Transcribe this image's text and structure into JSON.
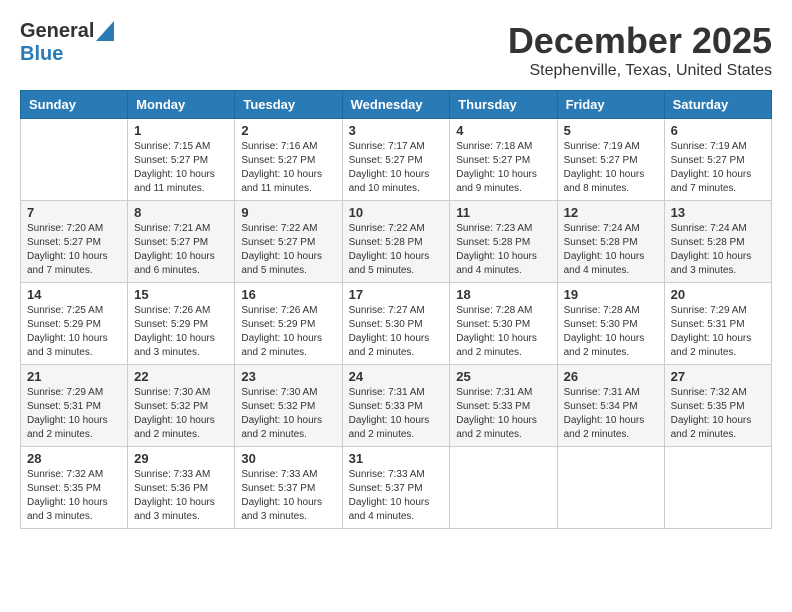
{
  "header": {
    "logo_line1": "General",
    "logo_line2": "Blue",
    "month_title": "December 2025",
    "location": "Stephenville, Texas, United States"
  },
  "days_of_week": [
    "Sunday",
    "Monday",
    "Tuesday",
    "Wednesday",
    "Thursday",
    "Friday",
    "Saturday"
  ],
  "weeks": [
    [
      {
        "day": "",
        "info": ""
      },
      {
        "day": "1",
        "info": "Sunrise: 7:15 AM\nSunset: 5:27 PM\nDaylight: 10 hours\nand 11 minutes."
      },
      {
        "day": "2",
        "info": "Sunrise: 7:16 AM\nSunset: 5:27 PM\nDaylight: 10 hours\nand 11 minutes."
      },
      {
        "day": "3",
        "info": "Sunrise: 7:17 AM\nSunset: 5:27 PM\nDaylight: 10 hours\nand 10 minutes."
      },
      {
        "day": "4",
        "info": "Sunrise: 7:18 AM\nSunset: 5:27 PM\nDaylight: 10 hours\nand 9 minutes."
      },
      {
        "day": "5",
        "info": "Sunrise: 7:19 AM\nSunset: 5:27 PM\nDaylight: 10 hours\nand 8 minutes."
      },
      {
        "day": "6",
        "info": "Sunrise: 7:19 AM\nSunset: 5:27 PM\nDaylight: 10 hours\nand 7 minutes."
      }
    ],
    [
      {
        "day": "7",
        "info": "Sunrise: 7:20 AM\nSunset: 5:27 PM\nDaylight: 10 hours\nand 7 minutes."
      },
      {
        "day": "8",
        "info": "Sunrise: 7:21 AM\nSunset: 5:27 PM\nDaylight: 10 hours\nand 6 minutes."
      },
      {
        "day": "9",
        "info": "Sunrise: 7:22 AM\nSunset: 5:27 PM\nDaylight: 10 hours\nand 5 minutes."
      },
      {
        "day": "10",
        "info": "Sunrise: 7:22 AM\nSunset: 5:28 PM\nDaylight: 10 hours\nand 5 minutes."
      },
      {
        "day": "11",
        "info": "Sunrise: 7:23 AM\nSunset: 5:28 PM\nDaylight: 10 hours\nand 4 minutes."
      },
      {
        "day": "12",
        "info": "Sunrise: 7:24 AM\nSunset: 5:28 PM\nDaylight: 10 hours\nand 4 minutes."
      },
      {
        "day": "13",
        "info": "Sunrise: 7:24 AM\nSunset: 5:28 PM\nDaylight: 10 hours\nand 3 minutes."
      }
    ],
    [
      {
        "day": "14",
        "info": "Sunrise: 7:25 AM\nSunset: 5:29 PM\nDaylight: 10 hours\nand 3 minutes."
      },
      {
        "day": "15",
        "info": "Sunrise: 7:26 AM\nSunset: 5:29 PM\nDaylight: 10 hours\nand 3 minutes."
      },
      {
        "day": "16",
        "info": "Sunrise: 7:26 AM\nSunset: 5:29 PM\nDaylight: 10 hours\nand 2 minutes."
      },
      {
        "day": "17",
        "info": "Sunrise: 7:27 AM\nSunset: 5:30 PM\nDaylight: 10 hours\nand 2 minutes."
      },
      {
        "day": "18",
        "info": "Sunrise: 7:28 AM\nSunset: 5:30 PM\nDaylight: 10 hours\nand 2 minutes."
      },
      {
        "day": "19",
        "info": "Sunrise: 7:28 AM\nSunset: 5:30 PM\nDaylight: 10 hours\nand 2 minutes."
      },
      {
        "day": "20",
        "info": "Sunrise: 7:29 AM\nSunset: 5:31 PM\nDaylight: 10 hours\nand 2 minutes."
      }
    ],
    [
      {
        "day": "21",
        "info": "Sunrise: 7:29 AM\nSunset: 5:31 PM\nDaylight: 10 hours\nand 2 minutes."
      },
      {
        "day": "22",
        "info": "Sunrise: 7:30 AM\nSunset: 5:32 PM\nDaylight: 10 hours\nand 2 minutes."
      },
      {
        "day": "23",
        "info": "Sunrise: 7:30 AM\nSunset: 5:32 PM\nDaylight: 10 hours\nand 2 minutes."
      },
      {
        "day": "24",
        "info": "Sunrise: 7:31 AM\nSunset: 5:33 PM\nDaylight: 10 hours\nand 2 minutes."
      },
      {
        "day": "25",
        "info": "Sunrise: 7:31 AM\nSunset: 5:33 PM\nDaylight: 10 hours\nand 2 minutes."
      },
      {
        "day": "26",
        "info": "Sunrise: 7:31 AM\nSunset: 5:34 PM\nDaylight: 10 hours\nand 2 minutes."
      },
      {
        "day": "27",
        "info": "Sunrise: 7:32 AM\nSunset: 5:35 PM\nDaylight: 10 hours\nand 2 minutes."
      }
    ],
    [
      {
        "day": "28",
        "info": "Sunrise: 7:32 AM\nSunset: 5:35 PM\nDaylight: 10 hours\nand 3 minutes."
      },
      {
        "day": "29",
        "info": "Sunrise: 7:33 AM\nSunset: 5:36 PM\nDaylight: 10 hours\nand 3 minutes."
      },
      {
        "day": "30",
        "info": "Sunrise: 7:33 AM\nSunset: 5:37 PM\nDaylight: 10 hours\nand 3 minutes."
      },
      {
        "day": "31",
        "info": "Sunrise: 7:33 AM\nSunset: 5:37 PM\nDaylight: 10 hours\nand 4 minutes."
      },
      {
        "day": "",
        "info": ""
      },
      {
        "day": "",
        "info": ""
      },
      {
        "day": "",
        "info": ""
      }
    ]
  ]
}
